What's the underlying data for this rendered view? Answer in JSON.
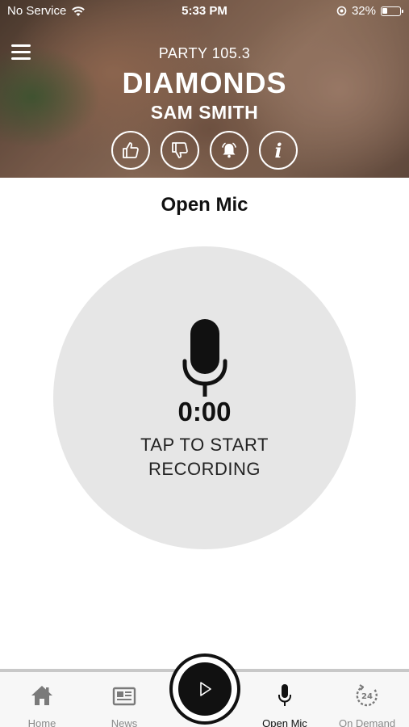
{
  "status_bar": {
    "carrier": "No Service",
    "time": "5:33 PM",
    "battery": "32%",
    "battery_level": 0.32
  },
  "header": {
    "station": "PARTY 105.3",
    "song_title": "DIAMONDS",
    "artist": "SAM SMITH",
    "actions": [
      "thumbs-up-icon",
      "thumbs-down-icon",
      "alarm-bell-icon",
      "info-icon"
    ],
    "info_glyph": "i"
  },
  "page": {
    "title": "Open Mic"
  },
  "recorder": {
    "timer": "0:00",
    "line1": "TAP TO START",
    "line2": "RECORDING"
  },
  "tabbar": {
    "tabs": [
      {
        "label": "Home",
        "icon": "home-icon",
        "active": false
      },
      {
        "label": "News",
        "icon": "newspaper-icon",
        "active": false
      },
      {
        "label": "Open Mic",
        "icon": "microphone-icon",
        "active": true
      },
      {
        "label": "On Demand",
        "icon": "24h-replay-icon",
        "active": false
      }
    ],
    "center_button": "play-icon"
  },
  "colors": {
    "accent": "#111111",
    "inactive": "#8a8a8a",
    "record_bg": "#e6e6e6",
    "header_text": "#ffffff"
  }
}
